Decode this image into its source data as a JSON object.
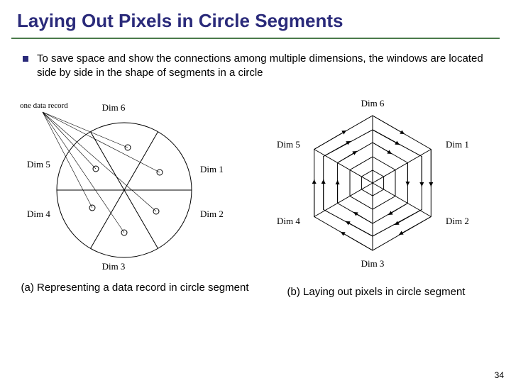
{
  "title": "Laying Out Pixels in Circle Segments",
  "bullet": "To save space and show the connections among multiple dimensions, the windows are located side by side in the shape of segments in a circle",
  "figA": {
    "note": "one data record",
    "labels": {
      "d1": "Dim 1",
      "d2": "Dim 2",
      "d3": "Dim 3",
      "d4": "Dim 4",
      "d5": "Dim 5",
      "d6": "Dim 6"
    }
  },
  "figB": {
    "labels": {
      "d1": "Dim 1",
      "d2": "Dim 2",
      "d3": "Dim 3",
      "d4": "Dim 4",
      "d5": "Dim 5",
      "d6": "Dim 6"
    }
  },
  "captionA": "(a) Representing a data record in circle segment",
  "captionB": "(b) Laying out pixels in circle segment",
  "pageNumber": "34"
}
